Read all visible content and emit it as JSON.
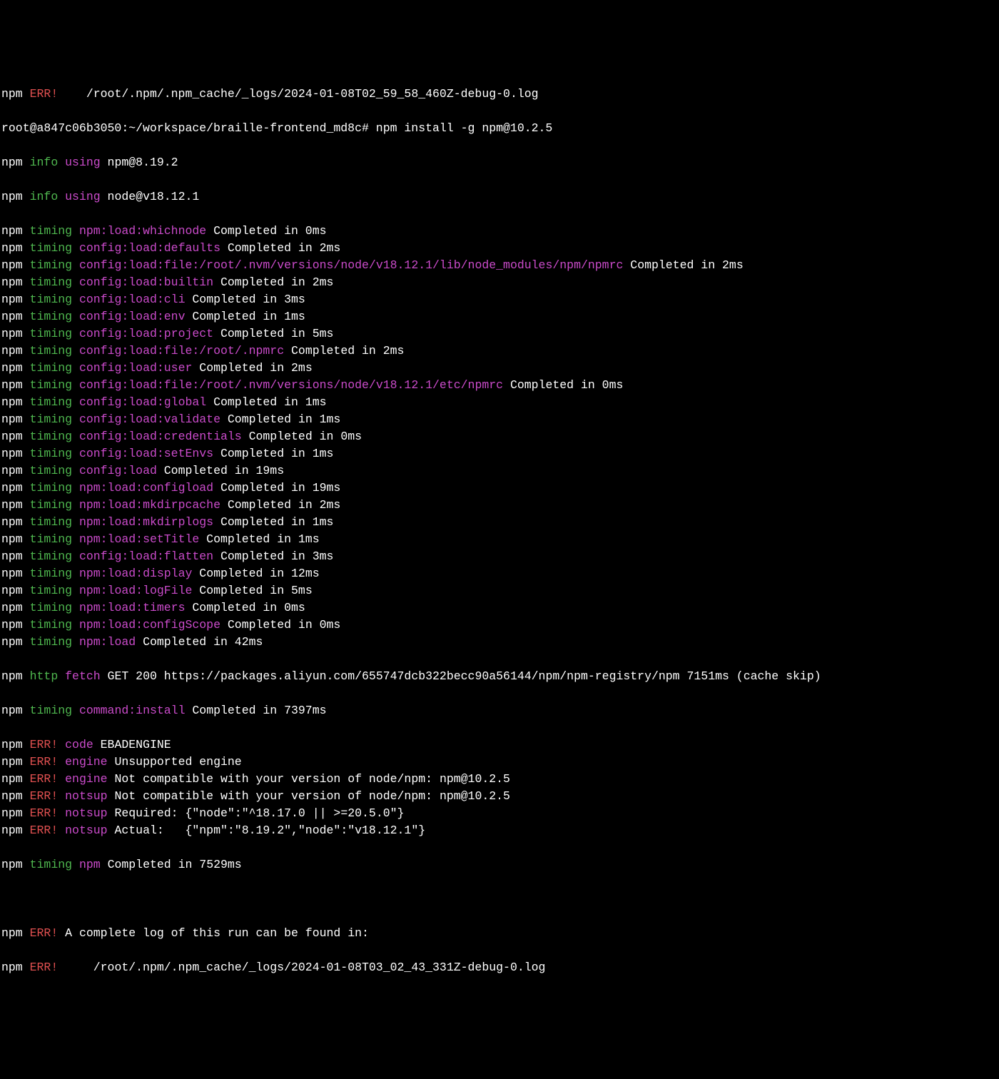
{
  "partial_err_top": {
    "npm": "npm",
    "err": "ERR!",
    "path": "    /root/.npm/.npm_cache/_logs/2024-01-08T02_59_58_460Z-debug-0.log"
  },
  "prompt": {
    "user_host": "root@a847c06b3050:~/workspace/braille-frontend_md8c#",
    "command": " npm install -g npm@10.2.5"
  },
  "info1": {
    "npm": "npm",
    "info": "info",
    "using": "using",
    "rest": " npm@8.19.2"
  },
  "info2": {
    "npm": "npm",
    "info": "info",
    "using": "using",
    "rest": " node@v18.12.1"
  },
  "timing_rows": [
    {
      "name": "npm:load:whichnode",
      "rest": " Completed in 0ms"
    },
    {
      "name": "config:load:defaults",
      "rest": " Completed in 2ms"
    },
    {
      "name": "config:load:file:/root/.nvm/versions/node/v18.12.1/lib/node_modules/npm/npmrc",
      "rest": " Completed in 2ms"
    },
    {
      "name": "config:load:builtin",
      "rest": " Completed in 2ms"
    },
    {
      "name": "config:load:cli",
      "rest": " Completed in 3ms"
    },
    {
      "name": "config:load:env",
      "rest": " Completed in 1ms"
    },
    {
      "name": "config:load:project",
      "rest": " Completed in 5ms"
    },
    {
      "name": "config:load:file:/root/.npmrc",
      "rest": " Completed in 2ms"
    },
    {
      "name": "config:load:user",
      "rest": " Completed in 2ms"
    },
    {
      "name": "config:load:file:/root/.nvm/versions/node/v18.12.1/etc/npmrc",
      "rest": " Completed in 0ms"
    },
    {
      "name": "config:load:global",
      "rest": " Completed in 1ms"
    },
    {
      "name": "config:load:validate",
      "rest": " Completed in 1ms"
    },
    {
      "name": "config:load:credentials",
      "rest": " Completed in 0ms"
    },
    {
      "name": "config:load:setEnvs",
      "rest": " Completed in 1ms"
    },
    {
      "name": "config:load",
      "rest": " Completed in 19ms"
    },
    {
      "name": "npm:load:configload",
      "rest": " Completed in 19ms"
    },
    {
      "name": "npm:load:mkdirpcache",
      "rest": " Completed in 2ms"
    },
    {
      "name": "npm:load:mkdirplogs",
      "rest": " Completed in 1ms"
    },
    {
      "name": "npm:load:setTitle",
      "rest": " Completed in 1ms"
    },
    {
      "name": "config:load:flatten",
      "rest": " Completed in 3ms"
    },
    {
      "name": "npm:load:display",
      "rest": " Completed in 12ms"
    },
    {
      "name": "npm:load:logFile",
      "rest": " Completed in 5ms"
    },
    {
      "name": "npm:load:timers",
      "rest": " Completed in 0ms"
    },
    {
      "name": "npm:load:configScope",
      "rest": " Completed in 0ms"
    },
    {
      "name": "npm:load",
      "rest": " Completed in 42ms"
    }
  ],
  "labels": {
    "npm": "npm",
    "timing": "timing",
    "http": "http",
    "fetch": "fetch",
    "err": "ERR!"
  },
  "http_row": {
    "rest": " GET 200 https://packages.aliyun.com/655747dcb322becc90a56144/npm/npm-registry/npm 7151ms (cache skip)"
  },
  "timing_cmd": {
    "name": "command:install",
    "rest": " Completed in 7397ms"
  },
  "err_rows": [
    {
      "cat": "code",
      "rest": " EBADENGINE"
    },
    {
      "cat": "engine",
      "rest": " Unsupported engine"
    },
    {
      "cat": "engine",
      "rest": " Not compatible with your version of node/npm: npm@10.2.5"
    },
    {
      "cat": "notsup",
      "rest": " Not compatible with your version of node/npm: npm@10.2.5"
    },
    {
      "cat": "notsup",
      "rest": " Required: {\"node\":\"^18.17.0 || >=20.5.0\"}"
    },
    {
      "cat": "notsup",
      "rest": " Actual:   {\"npm\":\"8.19.2\",\"node\":\"v18.12.1\"}"
    }
  ],
  "timing_npm": {
    "name": "npm",
    "rest": " Completed in 7529ms"
  },
  "tail_err1": {
    "rest": " A complete log of this run can be found in:"
  },
  "tail_err2": {
    "rest": "     /root/.npm/.npm_cache/_logs/2024-01-08T03_02_43_331Z-debug-0.log"
  }
}
